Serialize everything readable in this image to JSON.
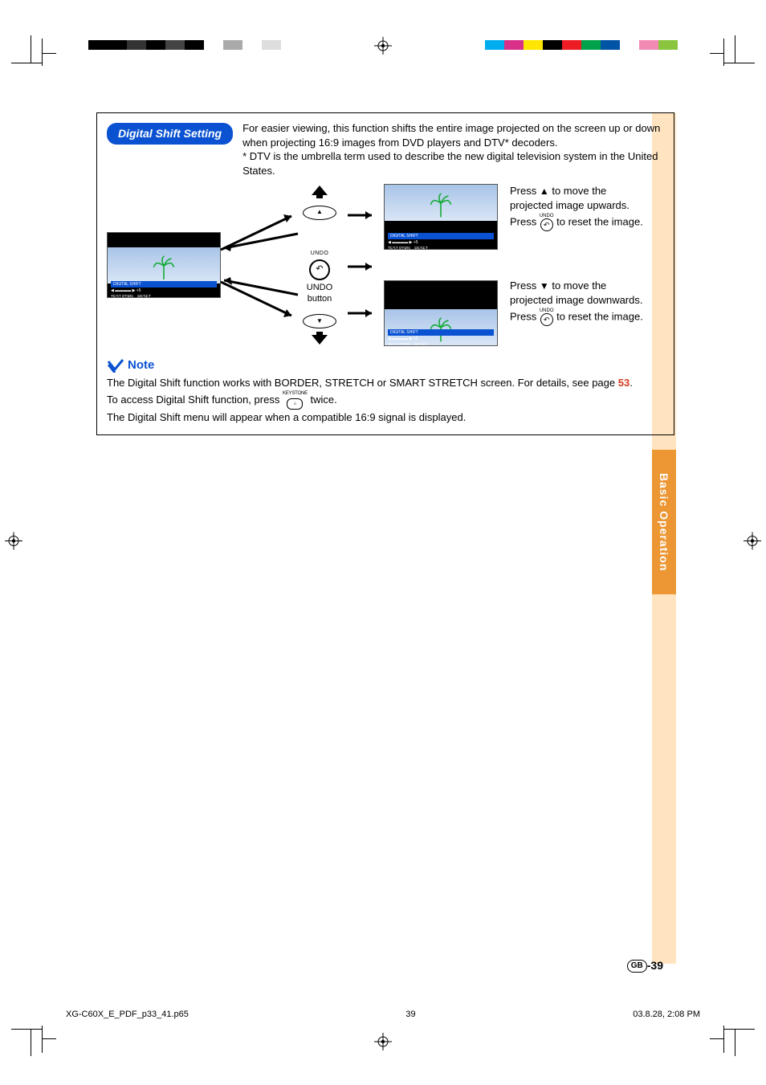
{
  "header_pill": "Digital Shift Setting",
  "intro": {
    "para": "For easier viewing, this function shifts the entire image projected on the screen up or down when projecting 16:9 images from DVD players and DTV* decoders.",
    "footnote": "* DTV is the umbrella term used to describe the new digital television system in the United States."
  },
  "controls": {
    "undo_small_label": "UNDO",
    "undo_button_label": "UNDO button",
    "keystone_small_label": "KEYSTONE"
  },
  "osd": {
    "title": "DIGITAL SHIFT",
    "value": "+5",
    "left_hint": "TEST PTRN",
    "right_hint": "RESET"
  },
  "side": {
    "up_line1_a": "Press ",
    "up_line1_b": " to move the projected image upwards.",
    "up_line2_a": "Press ",
    "up_line2_b": " to reset the image.",
    "down_line1_a": "Press ",
    "down_line1_b": " to move the projected image downwards.",
    "down_line2_a": "Press ",
    "down_line2_b": " to reset the image."
  },
  "note_heading": "Note",
  "notes": {
    "line1_a": "The Digital Shift function works with BORDER, STRETCH or SMART STRETCH screen. For details, see page ",
    "page_ref": "53",
    "line1_b": ".",
    "line2_a": "To access Digital Shift function, press ",
    "line2_b": " twice.",
    "line3": "The Digital Shift menu will appear when a compatible 16:9 signal is displayed."
  },
  "side_tab_label": "Basic Operation",
  "page_number": "-39",
  "page_region": "GB",
  "footer": {
    "file": "XG-C60X_E_PDF_p33_41.p65",
    "sheet": "39",
    "timestamp": "03.8.28, 2:08 PM"
  },
  "colorbars": {
    "left": [
      "#000",
      "#000",
      "#333",
      "#000",
      "#444",
      "#000",
      "#fff",
      "#aaa",
      "#fff",
      "#ddd"
    ],
    "right": [
      "#00adee",
      "#d9318a",
      "#ffe600",
      "#000",
      "#ed1c24",
      "#00a14b",
      "#0054a6",
      "#fff",
      "#f18bb6",
      "#8bc53f"
    ]
  }
}
